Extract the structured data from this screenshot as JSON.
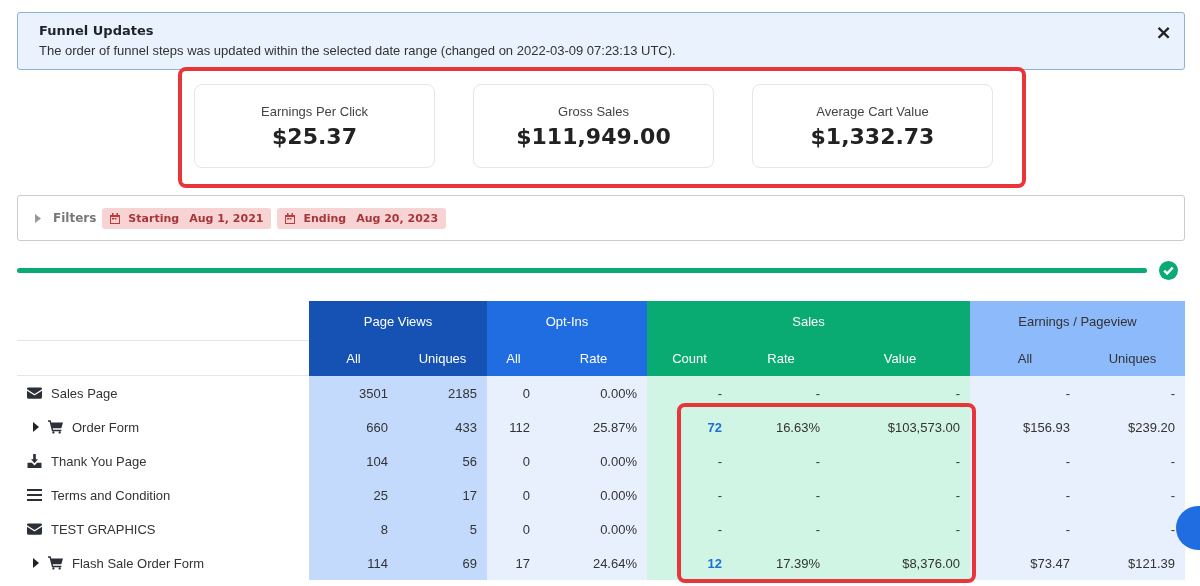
{
  "alert": {
    "title": "Funnel Updates",
    "message": "The order of funnel steps was updated within the selected date range (changed on 2022-03-09 07:23:13 UTC).",
    "close": "×"
  },
  "kpis": [
    {
      "label": "Earnings Per Click",
      "value": "$25.37"
    },
    {
      "label": "Gross Sales",
      "value": "$111,949.00"
    },
    {
      "label": "Average Cart Value",
      "value": "$1,332.73"
    }
  ],
  "filters": {
    "label": "Filters",
    "chips": [
      {
        "label": "Starting",
        "value": "Aug 1, 2021"
      },
      {
        "label": "Ending",
        "value": "Aug 20, 2023"
      }
    ]
  },
  "progress": {
    "level": 1
  },
  "table": {
    "groups": [
      {
        "label": "Page Views",
        "kind": "pageviews",
        "columns": [
          "All",
          "Uniques"
        ]
      },
      {
        "label": "Opt-Ins",
        "kind": "optins",
        "columns": [
          "All",
          "Rate"
        ]
      },
      {
        "label": "Sales",
        "kind": "sales",
        "columns": [
          "Count",
          "Rate",
          "Value"
        ]
      },
      {
        "label": "Earnings / Pageview",
        "kind": "earnings",
        "columns": [
          "All",
          "Uniques"
        ]
      }
    ],
    "rows": [
      {
        "name": "Sales Page",
        "kind": "envelope",
        "expandable": false,
        "count_link": false,
        "cells": [
          "3501",
          "2185",
          "0",
          "0.00%",
          "-",
          "-",
          "-",
          "-",
          "-"
        ]
      },
      {
        "name": "Order Form",
        "kind": "cart",
        "expandable": true,
        "count_link": true,
        "cells": [
          "660",
          "433",
          "112",
          "25.87%",
          "72",
          "16.63%",
          "$103,573.00",
          "$156.93",
          "$239.20"
        ]
      },
      {
        "name": "Thank You Page",
        "kind": "download",
        "expandable": false,
        "count_link": false,
        "cells": [
          "104",
          "56",
          "0",
          "0.00%",
          "-",
          "-",
          "-",
          "-",
          "-"
        ]
      },
      {
        "name": "Terms and Condition",
        "kind": "list",
        "expandable": false,
        "count_link": false,
        "cells": [
          "25",
          "17",
          "0",
          "0.00%",
          "-",
          "-",
          "-",
          "-",
          "-"
        ]
      },
      {
        "name": "TEST GRAPHICS",
        "kind": "envelope",
        "expandable": false,
        "count_link": false,
        "cells": [
          "8",
          "5",
          "0",
          "0.00%",
          "-",
          "-",
          "-",
          "-",
          "-"
        ]
      },
      {
        "name": "Flash Sale Order Form",
        "kind": "cart",
        "expandable": true,
        "count_link": true,
        "cells": [
          "114",
          "69",
          "17",
          "24.64%",
          "12",
          "17.39%",
          "$8,376.00",
          "$73.47",
          "$121.39"
        ]
      }
    ]
  }
}
